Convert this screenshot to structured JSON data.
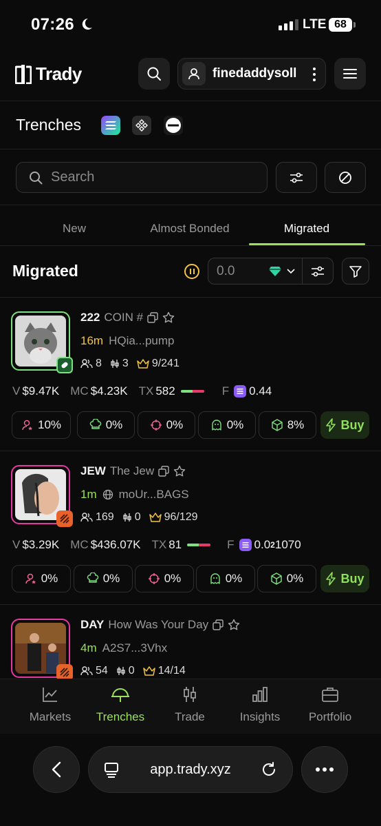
{
  "status_bar": {
    "time": "07:26",
    "network": "LTE",
    "battery": "68"
  },
  "header": {
    "brand": "Trady",
    "username": "finedaddysoll"
  },
  "trenches": {
    "title": "Trenches",
    "chains": [
      "solana-icon",
      "bnb-icon",
      "base-icon"
    ]
  },
  "search": {
    "placeholder": "Search"
  },
  "tabs": [
    {
      "label": "New"
    },
    {
      "label": "Almost Bonded"
    },
    {
      "label": "Migrated",
      "active": true
    }
  ],
  "section": {
    "title": "Migrated",
    "amount_value": "0.0"
  },
  "colors": {
    "accent": "#9be15d",
    "gold": "#f5c542",
    "pink": "#e63aa0",
    "green_border": "#7ee07e"
  },
  "tokens": [
    {
      "ticker": "222",
      "name": "COIN #",
      "age": "16m",
      "age_color": "#f5c542",
      "address": "HQia...pump",
      "holders": "8",
      "snipers": "3",
      "top_ratio": "9/241",
      "volume_label": "V",
      "volume": "$9.47K",
      "mc_label": "MC",
      "mc": "$4.23K",
      "tx_label": "TX",
      "tx": "582",
      "fee_label": "F",
      "fee": "0.44",
      "pills": [
        "10%",
        "0%",
        "0%",
        "0%",
        "8%"
      ],
      "buy_label": "Buy"
    },
    {
      "ticker": "JEW",
      "name": "The Jew",
      "age": "1m",
      "age_color": "#9be15d",
      "address": "moUr...BAGS",
      "holders": "169",
      "snipers": "0",
      "top_ratio": "96/129",
      "volume_label": "V",
      "volume": "$3.29K",
      "mc_label": "MC",
      "mc": "$436.07K",
      "tx_label": "TX",
      "tx": "81",
      "fee_label": "F",
      "fee": "0.0",
      "fee_subscript": "2",
      "fee_tail": "1070",
      "pills": [
        "0%",
        "0%",
        "0%",
        "0%",
        "0%"
      ],
      "buy_label": "Buy"
    },
    {
      "ticker": "DAY",
      "name": "How Was Your Day",
      "age": "4m",
      "age_color": "#9be15d",
      "address": "A2S7...3Vhx",
      "holders": "54",
      "snipers": "0",
      "top_ratio": "14/14"
    }
  ],
  "nav": [
    {
      "label": "Markets",
      "icon": "chart-line-icon"
    },
    {
      "label": "Trenches",
      "icon": "helmet-icon",
      "active": true
    },
    {
      "label": "Trade",
      "icon": "candles-icon"
    },
    {
      "label": "Insights",
      "icon": "bar-chart-icon"
    },
    {
      "label": "Portfolio",
      "icon": "briefcase-icon"
    }
  ],
  "browser": {
    "url": "app.trady.xyz"
  }
}
